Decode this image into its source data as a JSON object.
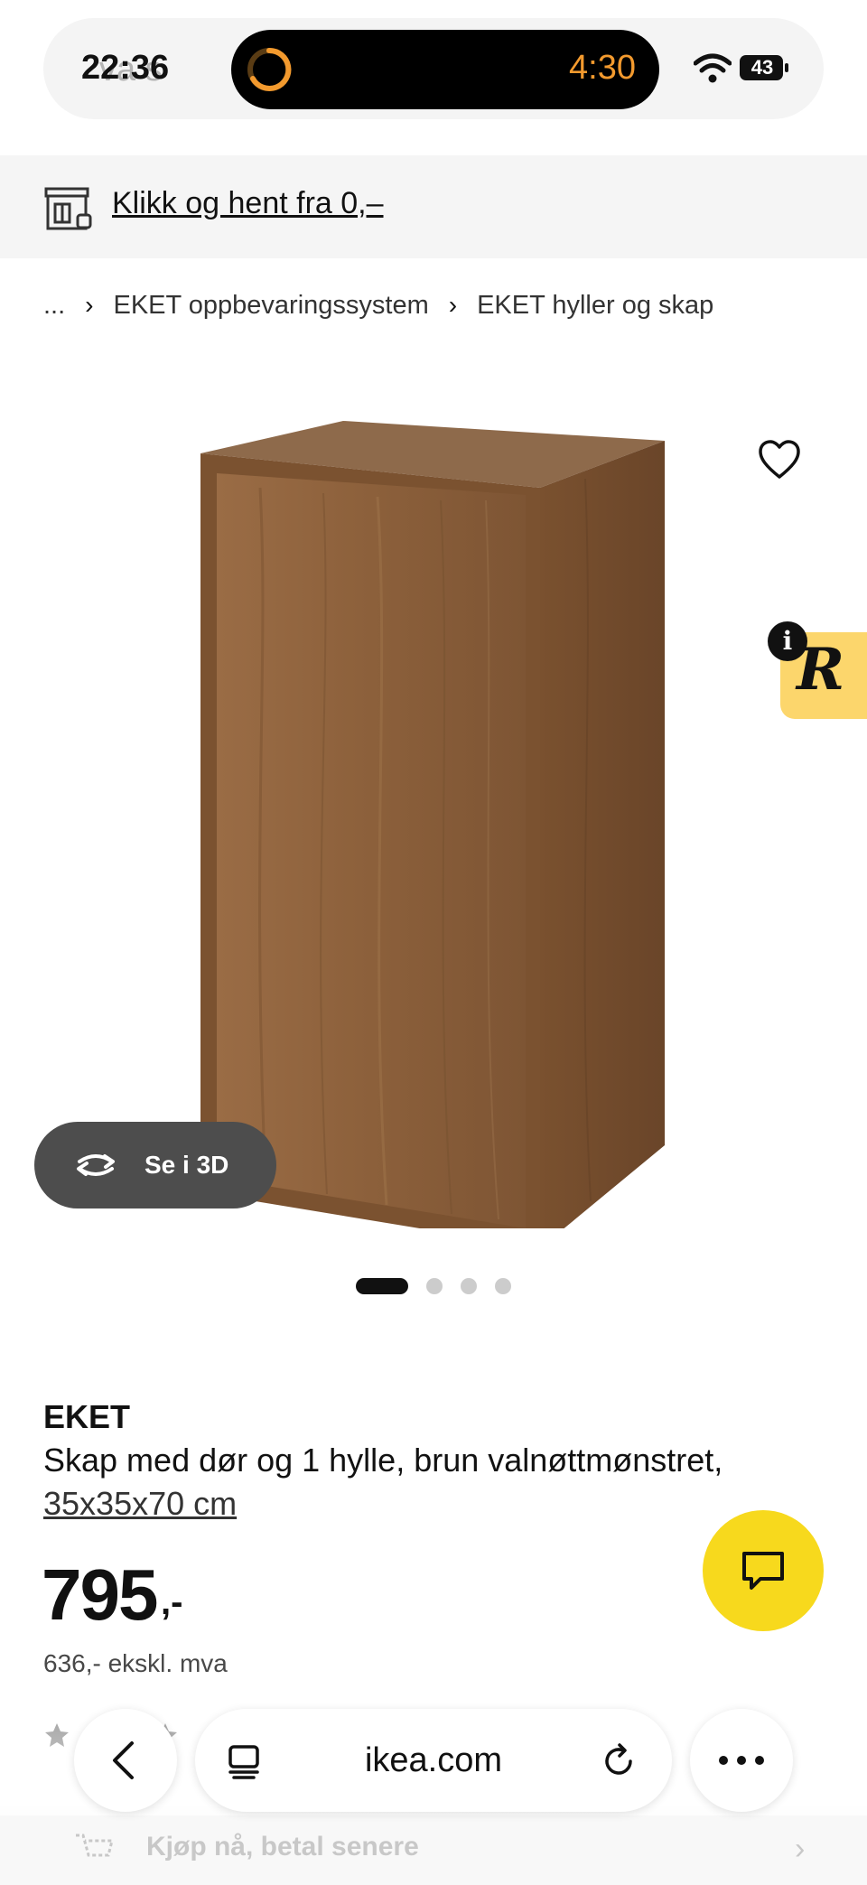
{
  "status_bar": {
    "time": "22:36",
    "ghost_search": "va s",
    "timer": "4:30",
    "battery": "43"
  },
  "promo": {
    "link_text": "Klikk og hent fra 0,–"
  },
  "breadcrumb": {
    "ellipsis": "...",
    "items": [
      "EKET oppbevaringssystem",
      "EKET hyller og skap"
    ]
  },
  "product_image": {
    "view_3d_label": "Se i 3D",
    "slide_count": 4,
    "active_slide": 1
  },
  "product": {
    "name": "EKET",
    "description": "Skap med dør og 1 hylle, brun valnøttmønstret,",
    "size": "35x35x70 cm",
    "price": "795",
    "price_suffix": ",-",
    "price_ex_vat": "636,- ekskl. mva"
  },
  "payment": {
    "bnpl_label": "Kjøp nå, betal senere"
  },
  "browser": {
    "url": "ikea.com"
  },
  "colors": {
    "accent_yellow": "#f7d91d",
    "badge_yellow": "#fcd66c",
    "timer_orange": "#f39a2e",
    "wood": "#8a5f3a"
  }
}
